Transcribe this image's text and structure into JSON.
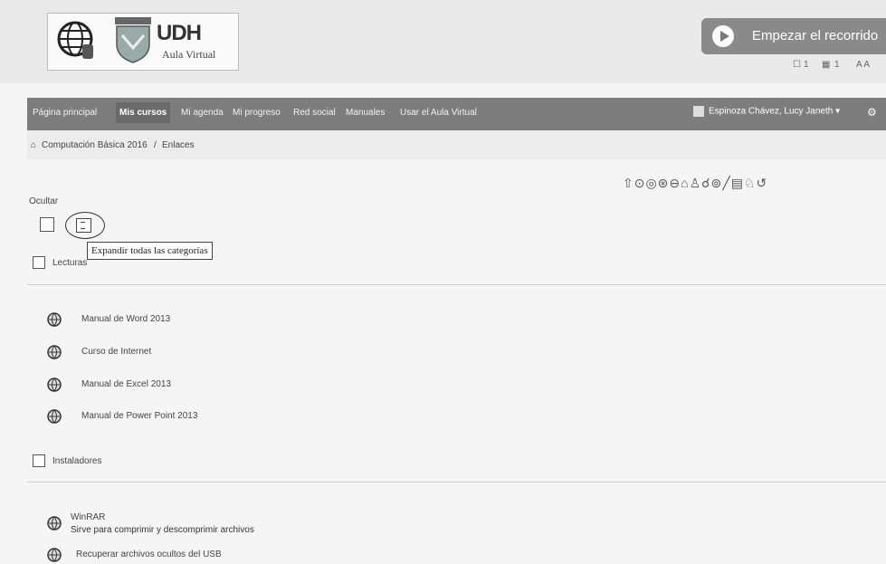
{
  "header": {
    "logo_text": "UDH",
    "logo_subtitle": "Aula Virtual",
    "start_tour_label": "Empezar el recorrido",
    "notif_count": "1",
    "msg_count": "1",
    "font_size_label": "A A"
  },
  "nav": {
    "items": [
      {
        "label": "Página principal"
      },
      {
        "label": "Mis cursos"
      },
      {
        "label": "Mi agenda"
      },
      {
        "label": "Mi progreso"
      },
      {
        "label": "Red social"
      },
      {
        "label": "Manuales"
      },
      {
        "label": "Usar el Aula Virtual"
      }
    ],
    "user_name": "Espinoza Chávez, Lucy Janeth"
  },
  "breadcrumb": {
    "course": "Computación Básica 2016",
    "separator": "/",
    "current": "Enlaces"
  },
  "toolbar": {
    "icons": "⇧⊙◎⊛⊖⌂♙☌⊚╱▤♘↺"
  },
  "controls": {
    "hide_label": "Ocultar",
    "expand_tooltip": "Expandir todas las categorías"
  },
  "categories": [
    {
      "title": "Lecturas",
      "links": [
        {
          "label": "Manual de Word 2013"
        },
        {
          "label": "Curso de Internet"
        },
        {
          "label": "Manual de Excel 2013"
        },
        {
          "label": "Manual de Power Point 2013"
        }
      ]
    },
    {
      "title": "Instaladores",
      "links": [
        {
          "label": "WinRAR",
          "description": "Sirve para comprimir y descomprimir archivos"
        },
        {
          "label": "Recuperar archivos ocultos del USB"
        }
      ]
    }
  ],
  "colors": {
    "nav_bg": "#7d7d7d",
    "header_bg": "#e9e9e9",
    "button_bg": "#8a8a8a"
  }
}
